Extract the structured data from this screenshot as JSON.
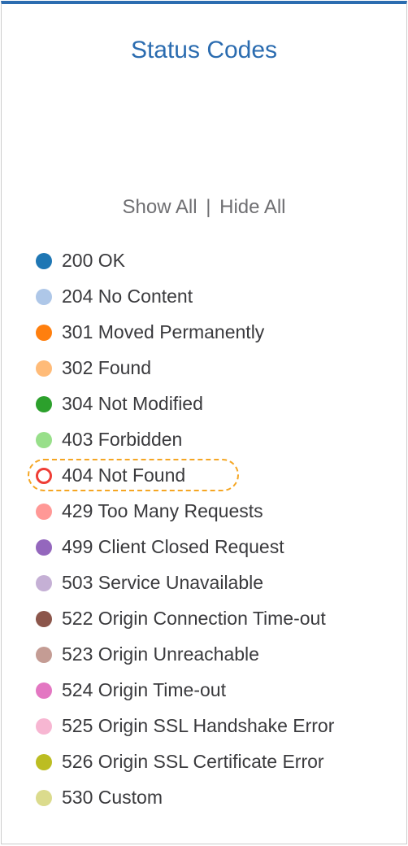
{
  "header": {
    "title": "Status Codes"
  },
  "controls": {
    "show_all": "Show All",
    "separator": "|",
    "hide_all": "Hide All"
  },
  "legend": [
    {
      "code": "200",
      "label": "200 OK",
      "color": "#1f77b4",
      "outline": false,
      "highlighted": false
    },
    {
      "code": "204",
      "label": "204 No Content",
      "color": "#aec7e8",
      "outline": false,
      "highlighted": false
    },
    {
      "code": "301",
      "label": "301 Moved Permanently",
      "color": "#ff7f0e",
      "outline": false,
      "highlighted": false
    },
    {
      "code": "302",
      "label": "302 Found",
      "color": "#ffbb78",
      "outline": false,
      "highlighted": false
    },
    {
      "code": "304",
      "label": "304 Not Modified",
      "color": "#2ca02c",
      "outline": false,
      "highlighted": false
    },
    {
      "code": "403",
      "label": "403 Forbidden",
      "color": "#98df8a",
      "outline": false,
      "highlighted": false
    },
    {
      "code": "404",
      "label": "404 Not Found",
      "color": "#ef3e36",
      "outline": true,
      "highlighted": true
    },
    {
      "code": "429",
      "label": "429 Too Many Requests",
      "color": "#ff9896",
      "outline": false,
      "highlighted": false
    },
    {
      "code": "499",
      "label": "499 Client Closed Request",
      "color": "#9467bd",
      "outline": false,
      "highlighted": false
    },
    {
      "code": "503",
      "label": "503 Service Unavailable",
      "color": "#c5b0d5",
      "outline": false,
      "highlighted": false
    },
    {
      "code": "522",
      "label": "522 Origin Connection Time-out",
      "color": "#8c564b",
      "outline": false,
      "highlighted": false
    },
    {
      "code": "523",
      "label": "523 Origin Unreachable",
      "color": "#c49c94",
      "outline": false,
      "highlighted": false
    },
    {
      "code": "524",
      "label": "524 Origin Time-out",
      "color": "#e377c2",
      "outline": false,
      "highlighted": false
    },
    {
      "code": "525",
      "label": "525 Origin SSL Handshake Error",
      "color": "#f7b6d2",
      "outline": false,
      "highlighted": false
    },
    {
      "code": "526",
      "label": "526 Origin SSL Certificate Error",
      "color": "#bcbd22",
      "outline": false,
      "highlighted": false
    },
    {
      "code": "530",
      "label": "530 Custom",
      "color": "#dbdb8d",
      "outline": false,
      "highlighted": false
    }
  ]
}
